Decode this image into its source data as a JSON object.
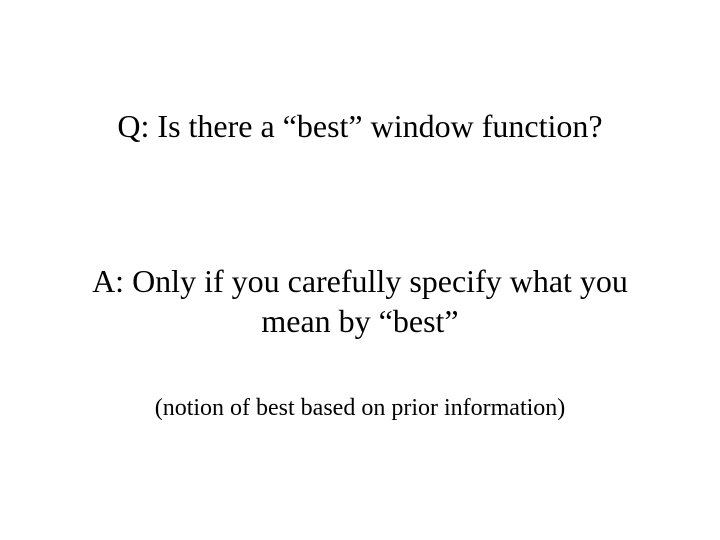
{
  "slide": {
    "question": "Q: Is there a “best” window function?",
    "answer": "A: Only if you carefully specify what you mean by “best”",
    "note": "(notion of best based on prior information)"
  }
}
